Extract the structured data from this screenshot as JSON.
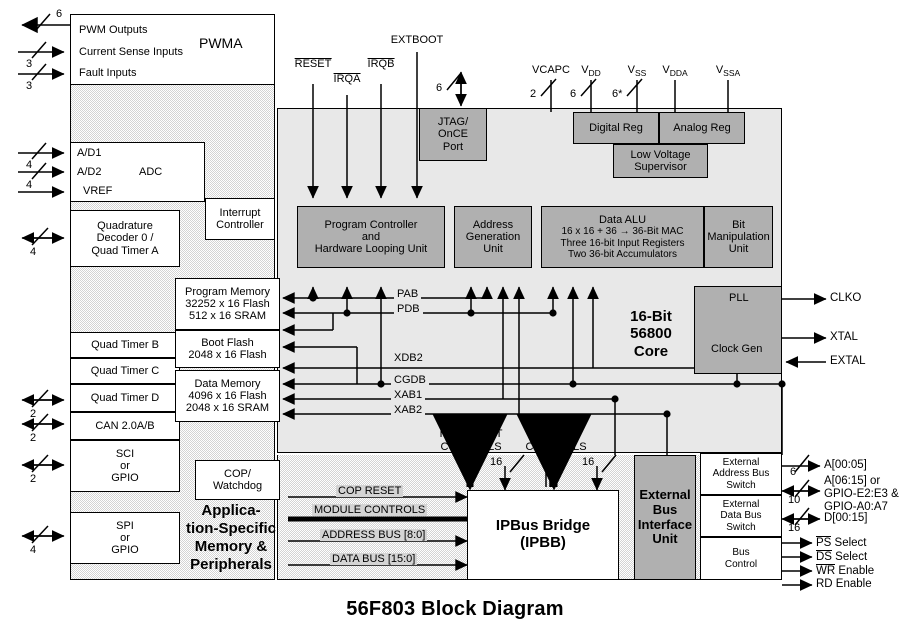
{
  "title": "56F803 Block Diagram",
  "left_ports": [
    {
      "name": "pwm-outputs",
      "label": "PWM Outputs",
      "width": "6",
      "dir": "out"
    },
    {
      "name": "current-sense-inputs",
      "label": "Current Sense Inputs",
      "width": "3",
      "dir": "in"
    },
    {
      "name": "fault-inputs",
      "label": "Fault Inputs",
      "width": "3",
      "dir": "in"
    },
    {
      "name": "ad1",
      "label": "A/D1",
      "width": "4",
      "dir": "in"
    },
    {
      "name": "ad2",
      "label": "A/D2",
      "width": "4",
      "dir": "in"
    },
    {
      "name": "vref",
      "label": "VREF",
      "width": "",
      "dir": "in"
    },
    {
      "name": "quad-decoder",
      "label": "",
      "width": "4",
      "dir": "bi"
    },
    {
      "name": "quad-timer-d",
      "label": "",
      "width": "2",
      "dir": "bi"
    },
    {
      "name": "can",
      "label": "",
      "width": "2",
      "dir": "bi"
    },
    {
      "name": "sci",
      "label": "",
      "width": "2",
      "dir": "bi"
    },
    {
      "name": "spi",
      "label": "",
      "width": "4",
      "dir": "bi"
    }
  ],
  "peripheral_blocks": {
    "pwma": {
      "title": "PWMA",
      "lines": [
        "PWM Outputs",
        "Current Sense Inputs",
        "Fault Inputs"
      ]
    },
    "adc": {
      "label": "ADC",
      "lines": [
        "A/D1",
        "A/D2",
        "VREF"
      ]
    },
    "quad_decoder": {
      "lines": [
        "Quadrature",
        "Decoder 0 /",
        "Quad Timer A"
      ]
    },
    "quad_timer_b": {
      "label": "Quad Timer B"
    },
    "quad_timer_c": {
      "label": "Quad Timer C"
    },
    "quad_timer_d": {
      "label": "Quad Timer D"
    },
    "can": {
      "label": "CAN 2.0A/B"
    },
    "sci": {
      "lines": [
        "SCI",
        "or",
        "GPIO"
      ]
    },
    "spi": {
      "lines": [
        "SPI",
        "or",
        "GPIO"
      ]
    },
    "asp": {
      "lines": [
        "Applica-",
        "tion-Specific",
        "Memory &",
        "Peripherals"
      ]
    },
    "cop": {
      "lines": [
        "COP/",
        "Watchdog"
      ]
    },
    "interrupt_controller": {
      "lines": [
        "Interrupt",
        "Controller"
      ]
    },
    "program_memory": {
      "lines": [
        "Program Memory",
        "32252 x 16 Flash",
        "512 x 16 SRAM"
      ]
    },
    "boot_flash": {
      "lines": [
        "Boot Flash",
        "2048 x 16 Flash"
      ]
    },
    "data_memory": {
      "lines": [
        "Data Memory",
        "4096 x 16 Flash",
        "2048 x 16 SRAM"
      ]
    }
  },
  "top_signals": [
    {
      "name": "reset",
      "label": "RESET",
      "overline": true
    },
    {
      "name": "irqa",
      "label": "IRQA",
      "overline": true
    },
    {
      "name": "irqb",
      "label": "IRQB",
      "overline": true
    },
    {
      "name": "extboot",
      "label": "EXTBOOT",
      "overline": false
    },
    {
      "name": "jtag-width",
      "label": "6",
      "overline": false
    },
    {
      "name": "vcapc",
      "label": "VCAPC",
      "sub": "",
      "width": "2"
    },
    {
      "name": "vdd",
      "label": "V",
      "sub": "DD",
      "width": "6"
    },
    {
      "name": "vss",
      "label": "V",
      "sub": "SS",
      "width": "6*"
    },
    {
      "name": "vdda",
      "label": "V",
      "sub": "DDA",
      "width": ""
    },
    {
      "name": "vssa",
      "label": "V",
      "sub": "SSA",
      "width": ""
    }
  ],
  "core_blocks": {
    "jtag": {
      "lines": [
        "JTAG/",
        "OnCE",
        "Port"
      ]
    },
    "digital_reg": {
      "label": "Digital Reg"
    },
    "analog_reg": {
      "label": "Analog Reg"
    },
    "low_voltage_supervisor": {
      "lines": [
        "Low Voltage",
        "Supervisor"
      ]
    },
    "program_controller": {
      "lines": [
        "Program Controller",
        "and",
        "Hardware Looping Unit"
      ]
    },
    "address_generation": {
      "lines": [
        "Address",
        "Generation",
        "Unit"
      ]
    },
    "data_alu": {
      "lines": [
        "Data ALU",
        "16 x 16 + 36 → 36-Bit MAC",
        "Three 16-bit Input Registers",
        "Two 36-bit Accumulators"
      ]
    },
    "bit_manipulation": {
      "lines": [
        "Bit",
        "Manipulation",
        "Unit"
      ]
    },
    "pll": {
      "label": "PLL"
    },
    "clock_gen": {
      "label": "Clock Gen"
    },
    "core_title": {
      "lines": [
        "16-Bit",
        "56800",
        "Core"
      ]
    },
    "ipbus_bridge": {
      "lines": [
        "IPBus Bridge",
        "(IPBB)"
      ]
    },
    "external_bus_interface": {
      "lines": [
        "External",
        "Bus",
        "Interface",
        "Unit"
      ]
    },
    "external_address_bus_switch": {
      "lines": [
        "External",
        "Address Bus",
        "Switch"
      ]
    },
    "external_data_bus_switch": {
      "lines": [
        "External",
        "Data Bus",
        "Switch"
      ]
    },
    "bus_control": {
      "lines": [
        "Bus",
        "Control"
      ]
    }
  },
  "bus_labels": [
    {
      "name": "pab",
      "label": "PAB"
    },
    {
      "name": "pdb",
      "label": "PDB"
    },
    {
      "name": "xdb2",
      "label": "XDB2"
    },
    {
      "name": "cgdb",
      "label": "CGDB"
    },
    {
      "name": "xab1",
      "label": "XAB1"
    },
    {
      "name": "xab2",
      "label": "XAB2"
    }
  ],
  "control_labels": [
    {
      "name": "interrupt-controls",
      "lines": [
        "INTERRUPT",
        "CONTROLS"
      ]
    },
    {
      "name": "ipbb-controls",
      "lines": [
        "IPBB",
        "CONTROLS"
      ]
    }
  ],
  "bottom_buses": [
    {
      "name": "cop-reset",
      "label": "COP RESET"
    },
    {
      "name": "module-controls",
      "label": "MODULE CONTROLS"
    },
    {
      "name": "address-bus",
      "label": "ADDRESS BUS [8:0]"
    },
    {
      "name": "data-bus",
      "label": "DATA BUS [15:0]"
    }
  ],
  "bridge_widths": [
    {
      "name": "ipbb-left-width",
      "label": "16"
    },
    {
      "name": "ipbb-right-width",
      "label": "16"
    }
  ],
  "right_signals": [
    {
      "name": "clko",
      "label": "CLKO",
      "dir": "out",
      "width": ""
    },
    {
      "name": "xtal",
      "label": "XTAL",
      "dir": "out",
      "width": ""
    },
    {
      "name": "extal",
      "label": "EXTAL",
      "dir": "in",
      "width": ""
    },
    {
      "name": "a-low",
      "label": "A[00:05]",
      "dir": "out",
      "width": "6"
    },
    {
      "name": "a-high-gpio",
      "label": "A[06:15] or\nGPIO-E2:E3 &\nGPIO-A0:A7",
      "dir": "bi",
      "width": "10"
    },
    {
      "name": "d-bus",
      "label": "D[00:15]",
      "dir": "bi",
      "width": "16"
    },
    {
      "name": "ps-select",
      "label": "PS Select",
      "dir": "out",
      "overline": "PS"
    },
    {
      "name": "ds-select",
      "label": "DS Select",
      "dir": "out",
      "overline": "DS"
    },
    {
      "name": "wr-enable",
      "label": "WR Enable",
      "dir": "out",
      "overline": "WR"
    },
    {
      "name": "rd-enable",
      "label": "RD Enable",
      "dir": "out",
      "overline": ""
    }
  ],
  "colors": {
    "gray_block": "#b0b0b0",
    "core_bg": "#e8e8e8",
    "hatch": "#d4d4d4",
    "line": "#000000"
  }
}
